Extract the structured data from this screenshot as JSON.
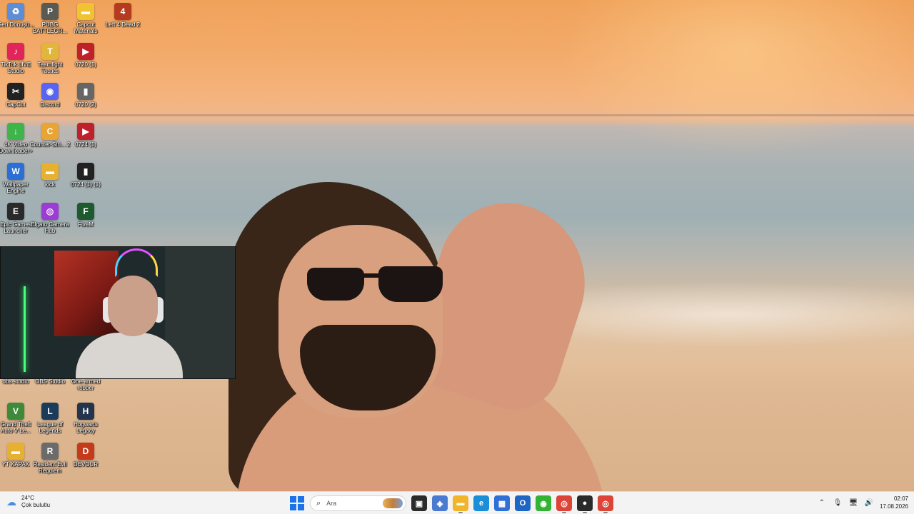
{
  "desktop": {
    "icons": [
      {
        "label": "Geri Dönüşü...",
        "icon": "recycle-bin-icon",
        "color": "#5c8ed8",
        "glyph": "♻"
      },
      {
        "label": "PUBG BATTLEGR...",
        "icon": "pubg-icon",
        "color": "#5a5a55",
        "glyph": "P"
      },
      {
        "label": "Capcut Materials",
        "icon": "folder-icon",
        "color": "#f1c232",
        "glyph": "▬"
      },
      {
        "label": "Left 4 Dead 2",
        "icon": "left4dead-icon",
        "color": "#b53a1e",
        "glyph": "4"
      },
      {
        "label": "TikTok LIVE Studio",
        "icon": "tiktok-icon",
        "color": "#e2245a",
        "glyph": "♪"
      },
      {
        "label": "Teamfight Tactics",
        "icon": "tft-icon",
        "color": "#e1b63a",
        "glyph": "T"
      },
      {
        "label": "0720 (1)",
        "icon": "video-file-icon",
        "color": "#c0202a",
        "glyph": "▶"
      },
      {
        "label": "CapCut",
        "icon": "capcut-icon",
        "color": "#222222",
        "glyph": "✂"
      },
      {
        "label": "Discord",
        "icon": "discord-icon",
        "color": "#5865f2",
        "glyph": "◉"
      },
      {
        "label": "0720 (2)",
        "icon": "video-file-icon",
        "color": "#666666",
        "glyph": "▮"
      },
      {
        "label": "4K Video Downloader+",
        "icon": "4k-downloader-icon",
        "color": "#3db54a",
        "glyph": "↓"
      },
      {
        "label": "Counter-Stri... 2",
        "icon": "cs2-icon",
        "color": "#e8a534",
        "glyph": "C"
      },
      {
        "label": "0724 (1)",
        "icon": "video-file-icon",
        "color": "#c0202a",
        "glyph": "▶"
      },
      {
        "label": "Wallpaper Engine",
        "icon": "wallpaper-engine-icon",
        "color": "#2b6fd6",
        "glyph": "W"
      },
      {
        "label": "kick",
        "icon": "folder-icon",
        "color": "#e8b030",
        "glyph": "▬"
      },
      {
        "label": "0724 (1) (1)",
        "icon": "video-file-icon",
        "color": "#222222",
        "glyph": "▮"
      },
      {
        "label": "Epic Games Launcher",
        "icon": "epic-games-icon",
        "color": "#2a2a2a",
        "glyph": "E"
      },
      {
        "label": "Elgato Camera Hub",
        "icon": "elgato-icon",
        "color": "#9b3cd4",
        "glyph": "◎"
      },
      {
        "label": "FiveM",
        "icon": "fivem-icon",
        "color": "#1f5a2e",
        "glyph": "F"
      },
      {
        "label": "obs-studio",
        "icon": "obs-icon",
        "color": "#333333",
        "glyph": "●"
      },
      {
        "label": "OBS Studio",
        "icon": "obs-icon",
        "color": "#333333",
        "glyph": "●"
      },
      {
        "label": "One-armed robber",
        "icon": "game-icon",
        "color": "#6a2b8c",
        "glyph": "R"
      },
      {
        "label": "Grand Theft Auto V Le...",
        "icon": "gta-icon",
        "color": "#3f8a3a",
        "glyph": "V"
      },
      {
        "label": "League of Legends",
        "icon": "lol-icon",
        "color": "#1a3c5a",
        "glyph": "L"
      },
      {
        "label": "Hogwarts Legacy",
        "icon": "hogwarts-icon",
        "color": "#24344d",
        "glyph": "H"
      },
      {
        "label": "YT KAPAK",
        "icon": "folder-icon",
        "color": "#e8b030",
        "glyph": "▬"
      },
      {
        "label": "Resident Evil Requiem",
        "icon": "resident-evil-icon",
        "color": "#6b6b6b",
        "glyph": "R"
      },
      {
        "label": "DEVOUR",
        "icon": "devour-icon",
        "color": "#c43a1a",
        "glyph": "D"
      }
    ]
  },
  "webcam": {
    "description_icon": "webcam-overlay"
  },
  "taskbar": {
    "weather": {
      "temp": "24°C",
      "condition": "Çok bulutlu",
      "icon": "cloud-sun-icon"
    },
    "search_placeholder": "Ara",
    "apps": [
      {
        "name": "task-view",
        "icon": "task-view-icon",
        "color": "#2b2b2b",
        "glyph": "▣",
        "active": false
      },
      {
        "name": "copilot",
        "icon": "copilot-icon",
        "color": "#4a7bd0",
        "glyph": "◈",
        "active": false
      },
      {
        "name": "file-explorer",
        "icon": "folder-icon",
        "color": "#f1b52a",
        "glyph": "▬",
        "active": true
      },
      {
        "name": "edge",
        "icon": "edge-icon",
        "color": "#1a8fd8",
        "glyph": "e",
        "active": false
      },
      {
        "name": "store",
        "icon": "store-icon",
        "color": "#2f6fd6",
        "glyph": "▦",
        "active": false
      },
      {
        "name": "outlook",
        "icon": "outlook-icon",
        "color": "#1f66c4",
        "glyph": "O",
        "active": false
      },
      {
        "name": "app-green",
        "icon": "chat-icon",
        "color": "#34b233",
        "glyph": "◉",
        "active": false
      },
      {
        "name": "chrome",
        "icon": "chrome-icon",
        "color": "#db4437",
        "glyph": "◎",
        "active": true
      },
      {
        "name": "obs",
        "icon": "obs-icon",
        "color": "#2a2a2a",
        "glyph": "●",
        "active": true
      },
      {
        "name": "chrome-2",
        "icon": "chrome-icon",
        "color": "#db4437",
        "glyph": "◎",
        "active": true
      }
    ],
    "tray": {
      "icons": [
        "chevron-up-icon",
        "microphone-icon",
        "network-icon",
        "volume-icon"
      ],
      "glyphs": [
        "⌃",
        "🎙",
        "🖥",
        "🔊"
      ],
      "time": "02:07",
      "date": "17.08.2026"
    }
  }
}
